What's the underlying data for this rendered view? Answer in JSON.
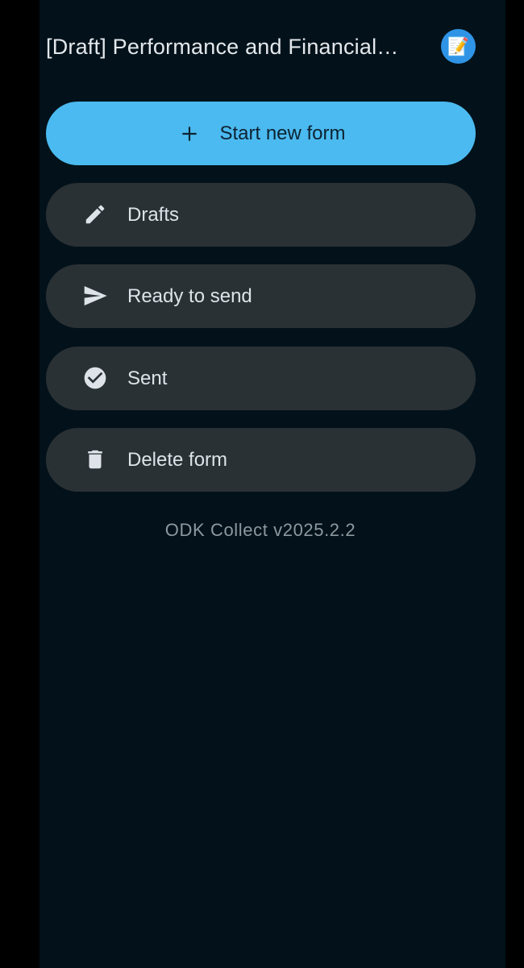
{
  "header": {
    "title": "[Draft] Performance and Financial…",
    "avatar_icon": "memo-icon",
    "avatar_glyph": "📝"
  },
  "menu": {
    "start_new_form": {
      "label": "Start new form",
      "icon": "plus-icon"
    },
    "drafts": {
      "label": "Drafts",
      "icon": "pencil-icon"
    },
    "ready_to_send": {
      "label": "Ready to send",
      "icon": "send-icon"
    },
    "sent": {
      "label": "Sent",
      "icon": "check-circle-icon"
    },
    "delete_form": {
      "label": "Delete form",
      "icon": "trash-icon"
    }
  },
  "footer": {
    "version": "ODK Collect v2025.2.2"
  },
  "colors": {
    "background": "#03121a",
    "primary": "#4bbaf0",
    "pill": "#2a3135",
    "avatar": "#2f94e6"
  }
}
